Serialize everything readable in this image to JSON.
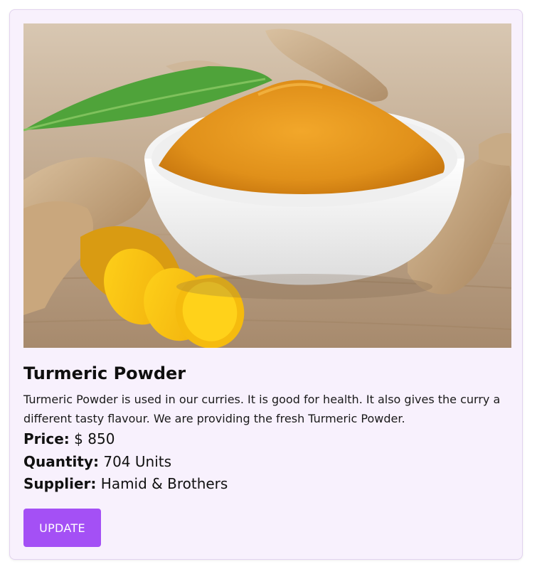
{
  "product": {
    "image_alt": "Turmeric powder in a white bowl with fresh turmeric roots",
    "title": "Turmeric Powder",
    "description": "Turmeric Powder is used in our curries. It is good for health. It also gives the curry a different tasty flavour. We are providing the fresh Turmeric Powder.",
    "price_label": "Price:",
    "price_value": "$ 850",
    "quantity_label": "Quantity:",
    "quantity_value": "704 Units",
    "supplier_label": "Supplier:",
    "supplier_value": "Hamid & Brothers",
    "update_label": "UPDATE"
  },
  "colors": {
    "card_background": "#f8f1fd",
    "button_accent": "#a450f5",
    "turmeric": "#e69a1b"
  }
}
